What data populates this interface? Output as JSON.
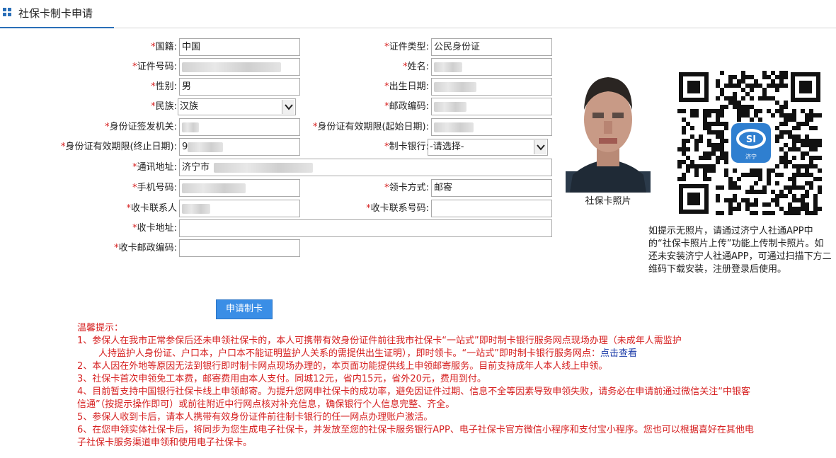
{
  "header": {
    "title": "社保卡制卡申请"
  },
  "form": {
    "required_mark": "*",
    "nationality": {
      "label": "国籍:",
      "value": "中国"
    },
    "id_type": {
      "label": "证件类型:",
      "value": "公民身份证"
    },
    "id_number": {
      "label": "证件号码:",
      "value": ""
    },
    "name": {
      "label": "姓名:",
      "value": ""
    },
    "gender": {
      "label": "性别:",
      "value": "男"
    },
    "birth_date": {
      "label": "出生日期:",
      "value": ""
    },
    "ethnicity": {
      "label": "民族:",
      "value": "汉族"
    },
    "postal_code": {
      "label": "邮政编码:",
      "value": ""
    },
    "issuing_authority": {
      "label": "身份证签发机关:",
      "value": ""
    },
    "valid_from": {
      "label": "身份证有效期限(起始日期):",
      "value": ""
    },
    "valid_to": {
      "label": "身份证有效期限(终止日期):",
      "value": "9"
    },
    "bank": {
      "label": "制卡银行:",
      "value": "-请选择-"
    },
    "address": {
      "label": "通讯地址:",
      "value": "济宁市"
    },
    "phone": {
      "label": "手机号码:",
      "value": ""
    },
    "pickup_method": {
      "label": "领卡方式:",
      "value": "邮寄"
    },
    "recipient": {
      "label": "收卡联系人",
      "value": ""
    },
    "recipient_phone": {
      "label": "收卡联系号码:",
      "value": ""
    },
    "recipient_address": {
      "label": "收卡地址:",
      "value": ""
    },
    "recipient_postal": {
      "label": "收卡邮政编码:",
      "value": ""
    },
    "submit_label": "申请制卡"
  },
  "photo": {
    "caption": "社保卡照片"
  },
  "qr": {
    "badge_text": "济宁",
    "note": "如提示无照片，请通过济宁人社通APP中的“社保卡照片上传”功能上传制卡照片。如还未安装济宁人社通APP，可通过扫描下方二维码下载安装，注册登录后使用。"
  },
  "tips": {
    "title": "温馨提示：",
    "item1": "1、参保人在我市正常参保后还未申领社保卡的，本人可携带有效身份证件前往我市社保卡“一站式”即时制卡银行服务网点现场办理（未成年人需监护",
    "item1b": "人持监护人身份证、户口本，户口本不能证明监护人关系的需提供出生证明），即时领卡。“一站式”即时制卡银行服务网点：",
    "item1_link": "点击查看",
    "item2": "2、本人因在外地等原因无法到银行即时制卡网点现场办理的，本页面功能提供线上申领邮寄服务。目前支持成年人本人线上申领。",
    "item3": "3、社保卡首次申领免工本费，邮寄费用由本人支付。同城12元，省内15元，省外20元，费用到付。",
    "item4": "4、目前暂支持中国银行社保卡线上申领邮寄。为提升您网申社保卡的成功率，避免因证件过期、信息不全等因素导致申领失败，请务必在申请前通过微信关注“中银客信通”（按提示操作即可）或前往附近中行网点核对补充信息，确保银行个人信息完整、齐全。",
    "item5": "5、参保人收到卡后，请本人携带有效身份证件前往制卡银行的任一网点办理账户激活。",
    "item6": "6、在您申领实体社保卡后，将同步为您生成电子社保卡，并发放至您的社保卡服务银行APP、电子社保卡官方微信小程序和支付宝小程序。您也可以根据喜好在其他电子社保卡服务渠道申领和使用电子社保卡。"
  },
  "colors": {
    "accent": "#2a6fb8",
    "button": "#3a8ee6",
    "tips": "#d62020",
    "link": "#1a3aa8"
  }
}
